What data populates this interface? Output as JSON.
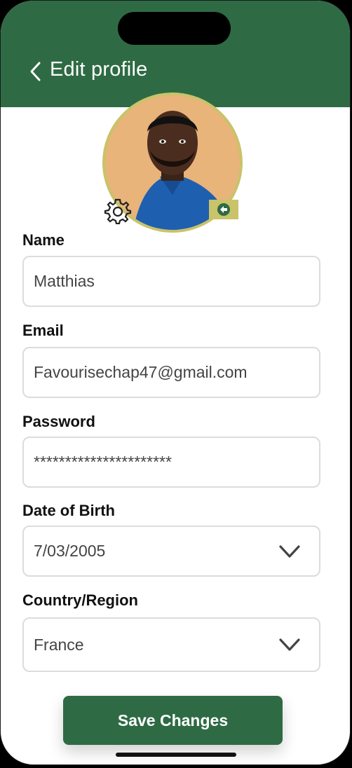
{
  "header": {
    "title": "Edit profile",
    "back_icon": "chevron-left-icon",
    "color": "#2e6b44"
  },
  "avatar": {
    "settings_icon": "gear-icon",
    "edit_badge_icon": "camera-swap-icon",
    "ring_color": "#c9c36a"
  },
  "form": {
    "name": {
      "label": "Name",
      "value": "Matthias"
    },
    "email": {
      "label": "Email",
      "value": "Favourisechap47@gmail.com"
    },
    "password": {
      "label": "Password",
      "value": "**********************"
    },
    "dob": {
      "label": "Date of Birth",
      "value": "7/03/2005"
    },
    "country": {
      "label": "Country/Region",
      "value": "France"
    }
  },
  "save_button": {
    "label": "Save Changes"
  }
}
